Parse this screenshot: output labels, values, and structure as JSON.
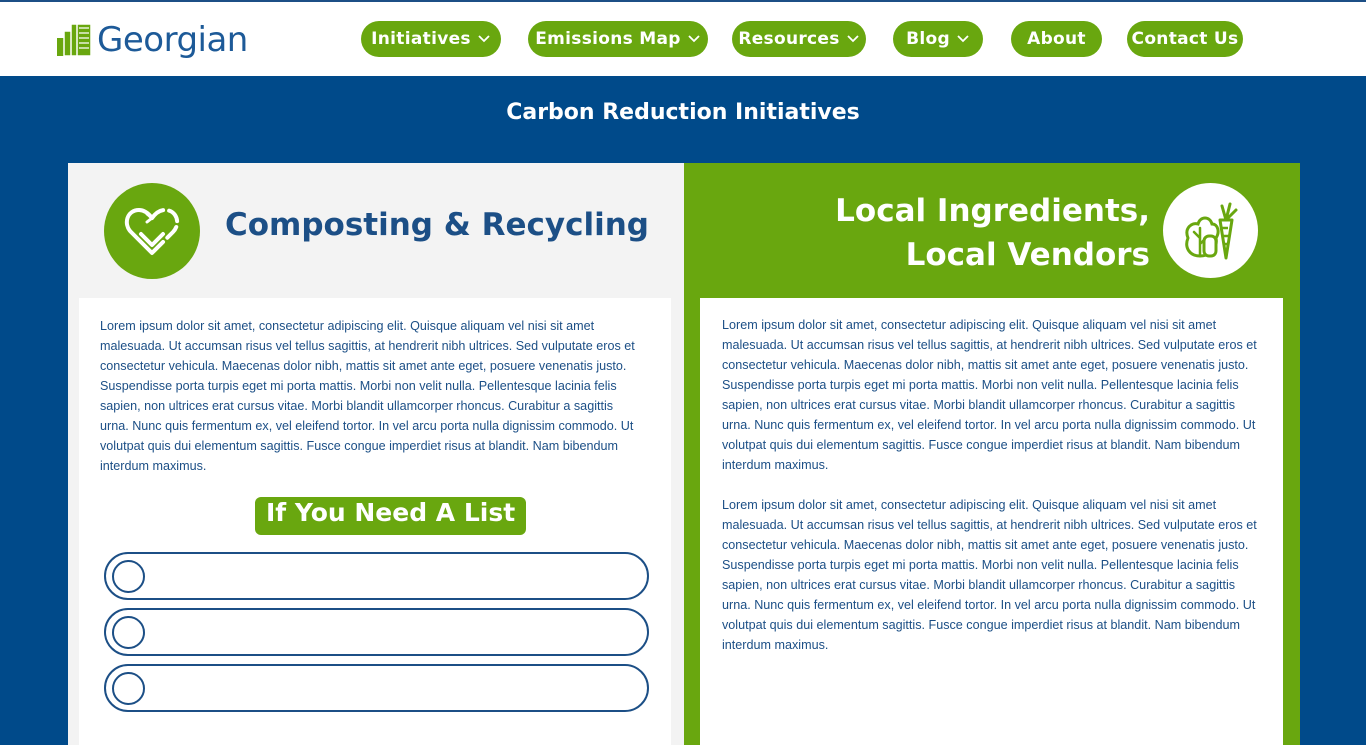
{
  "header": {
    "logo_text": "Georgian",
    "nav": [
      {
        "label": "Initiatives",
        "has_dropdown": true
      },
      {
        "label": "Emissions Map",
        "has_dropdown": true
      },
      {
        "label": "Resources",
        "has_dropdown": true
      },
      {
        "label": "Blog",
        "has_dropdown": true
      },
      {
        "label": "About",
        "has_dropdown": false
      },
      {
        "label": "Contact Us",
        "has_dropdown": false
      }
    ]
  },
  "page": {
    "title": "Carbon Reduction Initiatives"
  },
  "left": {
    "heading": "Composting & Recycling",
    "icon": "heart-recycle-icon",
    "body": "Lorem ipsum dolor sit amet, consectetur adipiscing elit. Quisque aliquam vel nisi sit amet malesuada. Ut accumsan risus vel tellus sagittis, at hendrerit nibh ultrices. Sed vulputate eros et consectetur vehicula. Maecenas dolor nibh, mattis sit amet ante eget, posuere venenatis justo. Suspendisse porta turpis eget mi porta mattis. Morbi non velit nulla. Pellentesque lacinia felis sapien, non ultrices erat cursus vitae. Morbi blandit ullamcorper rhoncus. Curabitur a sagittis urna. Nunc quis fermentum ex, vel eleifend tortor. In vel arcu porta nulla dignissim commodo. Ut volutpat quis dui elementum sagittis. Fusce congue imperdiet risus at blandit. Nam bibendum interdum maximus.",
    "list_title": "If You Need A List",
    "list_items": [
      "",
      "",
      ""
    ]
  },
  "right": {
    "heading_line1": "Local Ingredients,",
    "heading_line2": "Local Vendors",
    "icon": "vegetables-icon",
    "paragraphs": [
      "Lorem ipsum dolor sit amet, consectetur adipiscing elit. Quisque aliquam vel nisi sit amet malesuada. Ut accumsan risus vel tellus sagittis, at hendrerit nibh ultrices. Sed vulputate eros et consectetur vehicula. Maecenas dolor nibh, mattis sit amet ante eget, posuere venenatis justo. Suspendisse porta turpis eget mi porta mattis. Morbi non velit nulla. Pellentesque lacinia felis sapien, non ultrices erat cursus vitae. Morbi blandit ullamcorper rhoncus. Curabitur a sagittis urna. Nunc quis fermentum ex, vel eleifend tortor. In vel arcu porta nulla dignissim commodo. Ut volutpat quis dui elementum sagittis. Fusce congue imperdiet risus at blandit. Nam bibendum interdum maximus.",
      "Lorem ipsum dolor sit amet, consectetur adipiscing elit. Quisque aliquam vel nisi sit amet malesuada. Ut accumsan risus vel tellus sagittis, at hendrerit nibh ultrices. Sed vulputate eros et consectetur vehicula. Maecenas dolor nibh, mattis sit amet ante eget, posuere venenatis justo. Suspendisse porta turpis eget mi porta mattis. Morbi non velit nulla. Pellentesque lacinia felis sapien, non ultrices erat cursus vitae. Morbi blandit ullamcorper rhoncus. Curabitur a sagittis urna. Nunc quis fermentum ex, vel eleifend tortor. In vel arcu porta nulla dignissim commodo. Ut volutpat quis dui elementum sagittis. Fusce congue imperdiet risus at blandit. Nam bibendum interdum maximus."
    ]
  },
  "colors": {
    "brand_blue": "#1c4f86",
    "page_bg": "#004a8a",
    "accent_green": "#69a70f",
    "panel_grey": "#f3f3f3"
  }
}
